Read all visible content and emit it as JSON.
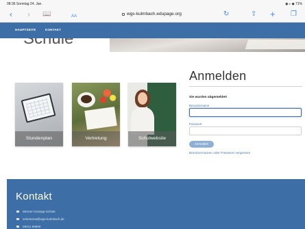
{
  "status_bar": {
    "time": "08:36",
    "date": "Sonntag 24. Jan.",
    "system": "◉ ▹ ◆ 71%"
  },
  "browser": {
    "aa_label": "AA",
    "url": "wgs-kulmbach.edupage.org",
    "accent_color": "#3b87f7"
  },
  "site_nav": {
    "items": [
      {
        "label": "HAUPTSEITE"
      },
      {
        "label": "KONTAKT"
      }
    ],
    "color": "#3d6fa6"
  },
  "hero": {
    "title": "Schule"
  },
  "tiles": [
    {
      "label": "Stundenplan"
    },
    {
      "label": "Vertretung"
    },
    {
      "label": "Schulwebsite"
    }
  ],
  "login": {
    "title": "Anmelden",
    "logout_message": "Sie wurden abgemeldet!",
    "username_label": "Benutzername",
    "username_value": "",
    "password_label": "Passwort",
    "password_value": "",
    "submit_label": "Anmelden",
    "forgot_link": "Benutzernamen oder Passwort vergessen"
  },
  "footer": {
    "title": "Kontakt",
    "lines": [
      "Werner-Grampp-Schule",
      "sekretariat@wgs-kulmbach.de",
      "09221 98890"
    ],
    "color": "#3d6fa6"
  }
}
